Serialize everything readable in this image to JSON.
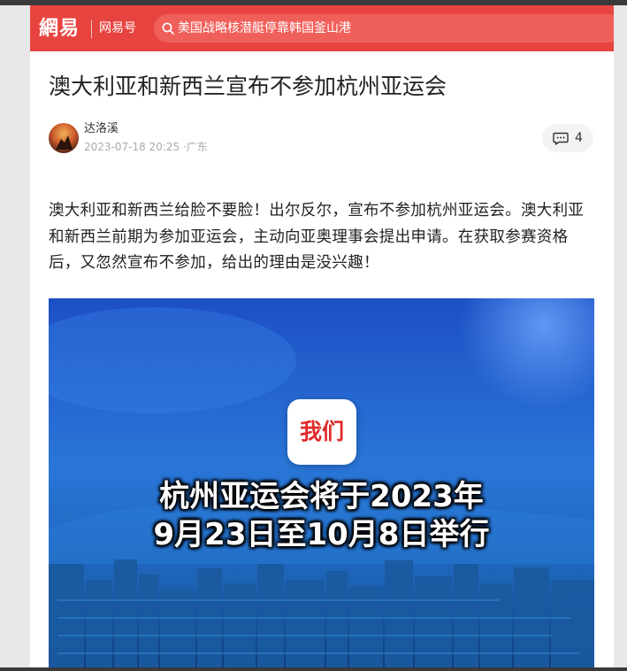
{
  "header": {
    "logo": "網易",
    "channel": "网易号",
    "search_text": "美国战略核潜艇停靠韩国釜山港",
    "accent_color": "#e8443f"
  },
  "article": {
    "title": "澳大利亚和新西兰宣布不参加杭州亚运会",
    "author": "达洛溪",
    "date": "2023-07-18 20:25",
    "location": "·广东",
    "comment_count": "4",
    "body": "澳大利亚和新西兰给脸不要脸！出尔反尔，宣布不参加杭州亚运会。澳大利亚和新西兰前期为参加亚运会，主动向亚奥理事会提出申请。在获取参赛资格后，又忽然宣布不参加，给出的理由是没兴趣！"
  },
  "image": {
    "app_label": "我们",
    "caption_line1": "杭州亚运会将于2023年",
    "caption_line2": "9月23日至10月8日举行"
  },
  "icons": {
    "search": "search-icon",
    "comment": "comment-icon"
  }
}
